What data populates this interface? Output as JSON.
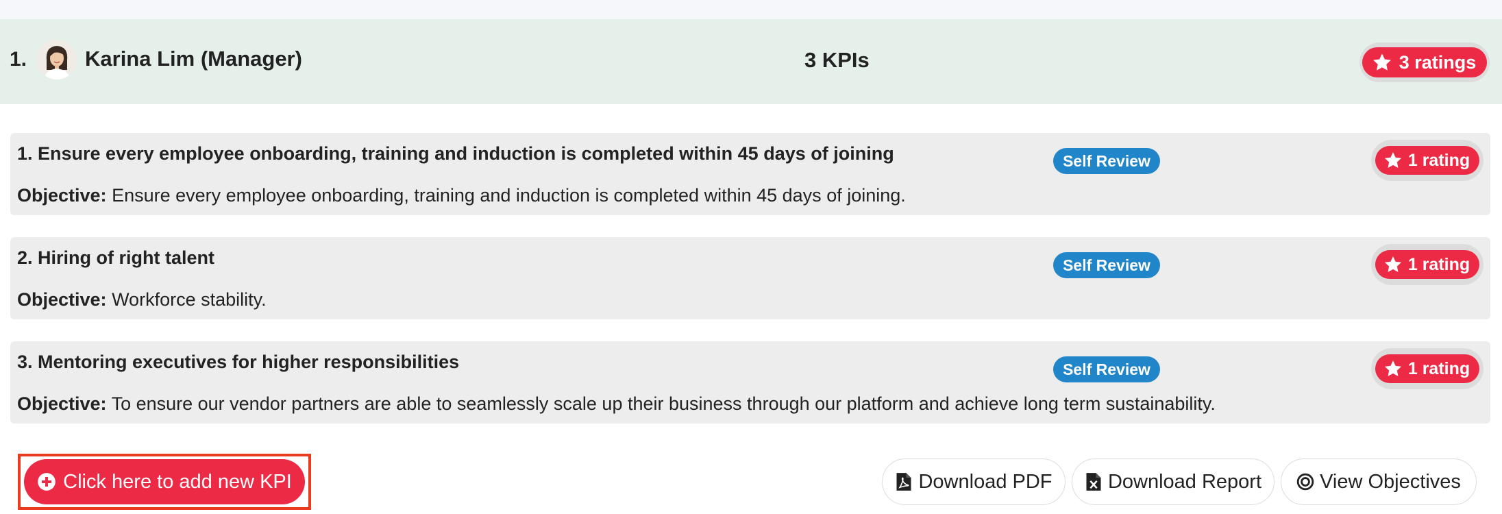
{
  "employee": {
    "number": "1.",
    "name": "Karina Lim (Manager)",
    "kpi_count": "3 KPIs",
    "rating": "3 ratings"
  },
  "kpis": [
    {
      "title": "1. Ensure every employee onboarding, training and induction is completed within 45 days of joining",
      "objective_label": "Objective:",
      "objective": "Ensure every employee onboarding, training and induction is completed within 45 days of joining.",
      "review_badge": "Self Review",
      "rating": "1 rating"
    },
    {
      "title": "2. Hiring of right talent",
      "objective_label": "Objective:",
      "objective": "Workforce stability.",
      "review_badge": "Self Review",
      "rating": "1 rating"
    },
    {
      "title": "3. Mentoring executives for higher responsibilities",
      "objective_label": "Objective:",
      "objective": "To ensure our vendor partners are able to seamlessly scale up their business through our platform and achieve long term sustainability.",
      "review_badge": "Self Review",
      "rating": "1 rating"
    }
  ],
  "actions": {
    "add_kpi": "Click here to add new KPI",
    "download_pdf": "Download PDF",
    "download_report": "Download Report",
    "view_objectives": "View Objectives"
  },
  "icons": {
    "rating": "star-icon",
    "add": "plus-circle-icon",
    "pdf": "file-pdf-icon",
    "report": "file-excel-icon",
    "objectives": "target-icon"
  },
  "colors": {
    "accent_red": "#ec2a45",
    "badge_blue": "#2185c9",
    "header_bg": "#e6f0ea",
    "card_bg": "#ededed",
    "highlight_frame": "#ea3a1f"
  }
}
